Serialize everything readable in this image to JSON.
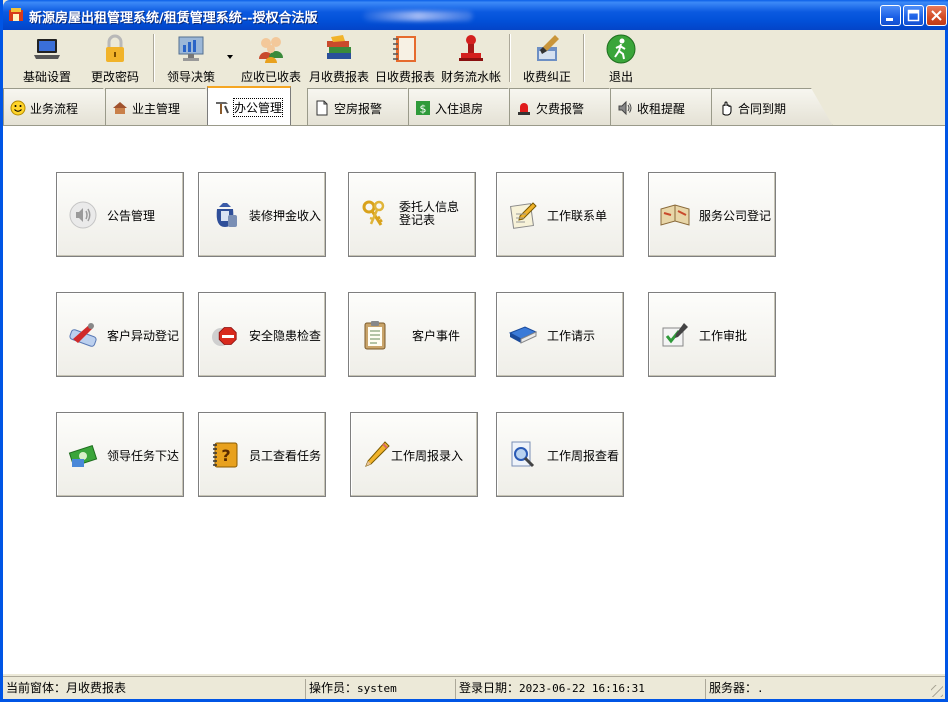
{
  "window": {
    "title": "新源房屋出租管理系统/租赁管理系统--授权合法版"
  },
  "toolbar": {
    "items": [
      {
        "label": "基础设置",
        "icon": "laptop-icon"
      },
      {
        "label": "更改密码",
        "icon": "padlock-icon"
      },
      {
        "label": "领导决策",
        "icon": "monitor-chart-icon"
      },
      {
        "label": "应收已收表",
        "icon": "people-icon"
      },
      {
        "label": "月收费报表",
        "icon": "books-icon"
      },
      {
        "label": "日收费报表",
        "icon": "notebook-icon"
      },
      {
        "label": "财务流水帐",
        "icon": "stamp-icon"
      },
      {
        "label": "收费纠正",
        "icon": "brush-icon"
      },
      {
        "label": "退出",
        "icon": "exit-icon"
      }
    ]
  },
  "tabs": [
    {
      "label": "业务流程",
      "icon": "smiley-icon"
    },
    {
      "label": "业主管理",
      "icon": "house-icon"
    },
    {
      "label": "办公管理",
      "icon": "tools-icon",
      "active": true
    },
    {
      "label": "空房报警",
      "icon": "document-icon"
    },
    {
      "label": "入住退房",
      "icon": "dollar-icon"
    },
    {
      "label": "欠费报警",
      "icon": "alarm-icon"
    },
    {
      "label": "收租提醒",
      "icon": "speaker-icon"
    },
    {
      "label": "合同到期",
      "icon": "hand-icon"
    }
  ],
  "tiles": [
    {
      "label": "公告管理",
      "icon": "speaker-icon"
    },
    {
      "label": "装修押金收入",
      "icon": "money-bag-icon"
    },
    {
      "label": "委托人信息登记表",
      "icon": "keys-icon"
    },
    {
      "label": "工作联系单",
      "icon": "note-pencil-icon"
    },
    {
      "label": "服务公司登记",
      "icon": "map-book-icon"
    },
    {
      "label": "客户异动登记",
      "icon": "wrench-blueprint-icon"
    },
    {
      "label": "安全隐患检查",
      "icon": "stop-sign-icon"
    },
    {
      "label": "客户事件",
      "icon": "clipboard-icon"
    },
    {
      "label": "工作请示",
      "icon": "blue-book-icon"
    },
    {
      "label": "工作审批",
      "icon": "checkmark-pencil-icon"
    },
    {
      "label": "领导任务下达",
      "icon": "cash-stack-icon"
    },
    {
      "label": "员工查看任务",
      "icon": "question-book-icon"
    },
    {
      "label": "工作周报录入",
      "icon": "pencil-icon"
    },
    {
      "label": "工作周报查看",
      "icon": "magnifier-doc-icon"
    }
  ],
  "statusbar": {
    "current_window": "当前窗体：月收费报表",
    "operator_label": "操作员：",
    "operator_value": "system",
    "login_label": "登录日期：",
    "login_value": "2023-06-22 16:16:31",
    "server_label": "服务器：",
    "server_value": "."
  }
}
